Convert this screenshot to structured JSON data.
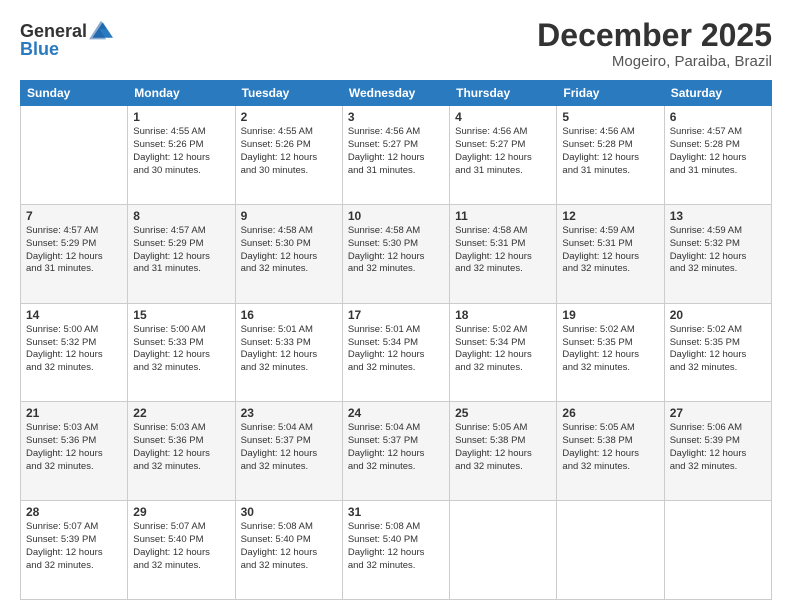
{
  "logo": {
    "line1": "General",
    "line2": "Blue"
  },
  "title": "December 2025",
  "subtitle": "Mogeiro, Paraiba, Brazil",
  "header_days": [
    "Sunday",
    "Monday",
    "Tuesday",
    "Wednesday",
    "Thursday",
    "Friday",
    "Saturday"
  ],
  "weeks": [
    [
      {
        "day": "",
        "info": ""
      },
      {
        "day": "1",
        "info": "Sunrise: 4:55 AM\nSunset: 5:26 PM\nDaylight: 12 hours\nand 30 minutes."
      },
      {
        "day": "2",
        "info": "Sunrise: 4:55 AM\nSunset: 5:26 PM\nDaylight: 12 hours\nand 30 minutes."
      },
      {
        "day": "3",
        "info": "Sunrise: 4:56 AM\nSunset: 5:27 PM\nDaylight: 12 hours\nand 31 minutes."
      },
      {
        "day": "4",
        "info": "Sunrise: 4:56 AM\nSunset: 5:27 PM\nDaylight: 12 hours\nand 31 minutes."
      },
      {
        "day": "5",
        "info": "Sunrise: 4:56 AM\nSunset: 5:28 PM\nDaylight: 12 hours\nand 31 minutes."
      },
      {
        "day": "6",
        "info": "Sunrise: 4:57 AM\nSunset: 5:28 PM\nDaylight: 12 hours\nand 31 minutes."
      }
    ],
    [
      {
        "day": "7",
        "info": "Sunrise: 4:57 AM\nSunset: 5:29 PM\nDaylight: 12 hours\nand 31 minutes."
      },
      {
        "day": "8",
        "info": "Sunrise: 4:57 AM\nSunset: 5:29 PM\nDaylight: 12 hours\nand 31 minutes."
      },
      {
        "day": "9",
        "info": "Sunrise: 4:58 AM\nSunset: 5:30 PM\nDaylight: 12 hours\nand 32 minutes."
      },
      {
        "day": "10",
        "info": "Sunrise: 4:58 AM\nSunset: 5:30 PM\nDaylight: 12 hours\nand 32 minutes."
      },
      {
        "day": "11",
        "info": "Sunrise: 4:58 AM\nSunset: 5:31 PM\nDaylight: 12 hours\nand 32 minutes."
      },
      {
        "day": "12",
        "info": "Sunrise: 4:59 AM\nSunset: 5:31 PM\nDaylight: 12 hours\nand 32 minutes."
      },
      {
        "day": "13",
        "info": "Sunrise: 4:59 AM\nSunset: 5:32 PM\nDaylight: 12 hours\nand 32 minutes."
      }
    ],
    [
      {
        "day": "14",
        "info": "Sunrise: 5:00 AM\nSunset: 5:32 PM\nDaylight: 12 hours\nand 32 minutes."
      },
      {
        "day": "15",
        "info": "Sunrise: 5:00 AM\nSunset: 5:33 PM\nDaylight: 12 hours\nand 32 minutes."
      },
      {
        "day": "16",
        "info": "Sunrise: 5:01 AM\nSunset: 5:33 PM\nDaylight: 12 hours\nand 32 minutes."
      },
      {
        "day": "17",
        "info": "Sunrise: 5:01 AM\nSunset: 5:34 PM\nDaylight: 12 hours\nand 32 minutes."
      },
      {
        "day": "18",
        "info": "Sunrise: 5:02 AM\nSunset: 5:34 PM\nDaylight: 12 hours\nand 32 minutes."
      },
      {
        "day": "19",
        "info": "Sunrise: 5:02 AM\nSunset: 5:35 PM\nDaylight: 12 hours\nand 32 minutes."
      },
      {
        "day": "20",
        "info": "Sunrise: 5:02 AM\nSunset: 5:35 PM\nDaylight: 12 hours\nand 32 minutes."
      }
    ],
    [
      {
        "day": "21",
        "info": "Sunrise: 5:03 AM\nSunset: 5:36 PM\nDaylight: 12 hours\nand 32 minutes."
      },
      {
        "day": "22",
        "info": "Sunrise: 5:03 AM\nSunset: 5:36 PM\nDaylight: 12 hours\nand 32 minutes."
      },
      {
        "day": "23",
        "info": "Sunrise: 5:04 AM\nSunset: 5:37 PM\nDaylight: 12 hours\nand 32 minutes."
      },
      {
        "day": "24",
        "info": "Sunrise: 5:04 AM\nSunset: 5:37 PM\nDaylight: 12 hours\nand 32 minutes."
      },
      {
        "day": "25",
        "info": "Sunrise: 5:05 AM\nSunset: 5:38 PM\nDaylight: 12 hours\nand 32 minutes."
      },
      {
        "day": "26",
        "info": "Sunrise: 5:05 AM\nSunset: 5:38 PM\nDaylight: 12 hours\nand 32 minutes."
      },
      {
        "day": "27",
        "info": "Sunrise: 5:06 AM\nSunset: 5:39 PM\nDaylight: 12 hours\nand 32 minutes."
      }
    ],
    [
      {
        "day": "28",
        "info": "Sunrise: 5:07 AM\nSunset: 5:39 PM\nDaylight: 12 hours\nand 32 minutes."
      },
      {
        "day": "29",
        "info": "Sunrise: 5:07 AM\nSunset: 5:40 PM\nDaylight: 12 hours\nand 32 minutes."
      },
      {
        "day": "30",
        "info": "Sunrise: 5:08 AM\nSunset: 5:40 PM\nDaylight: 12 hours\nand 32 minutes."
      },
      {
        "day": "31",
        "info": "Sunrise: 5:08 AM\nSunset: 5:40 PM\nDaylight: 12 hours\nand 32 minutes."
      },
      {
        "day": "",
        "info": ""
      },
      {
        "day": "",
        "info": ""
      },
      {
        "day": "",
        "info": ""
      }
    ]
  ]
}
